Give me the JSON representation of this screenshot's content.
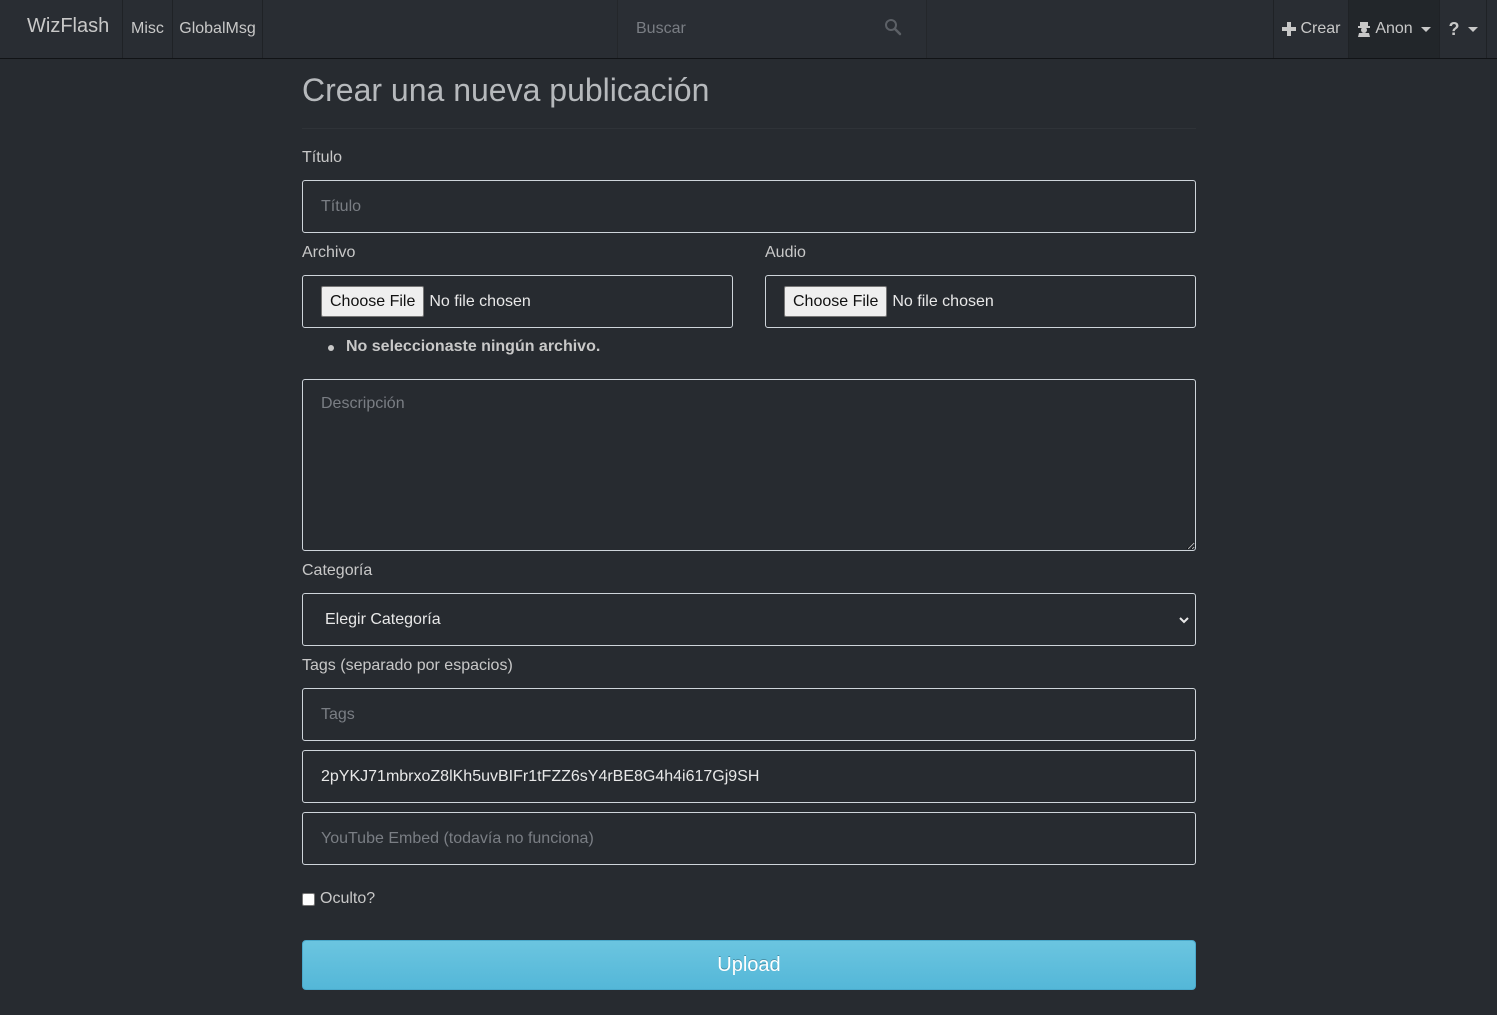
{
  "navbar": {
    "brand": "WizFlash",
    "links": [
      {
        "label": "Misc"
      },
      {
        "label": "GlobalMsg"
      }
    ],
    "search_placeholder": "Buscar",
    "create_label": "Crear",
    "user_label": "Anon",
    "help_label": "?"
  },
  "form": {
    "heading": "Crear una nueva publicación",
    "title_label": "Título",
    "title_placeholder": "Título",
    "file_label": "Archivo",
    "audio_label": "Audio",
    "choose_file_button": "Choose File",
    "no_file_text": "No file chosen",
    "file_error": "No seleccionaste ningún archivo.",
    "description_placeholder": "Descripción",
    "category_label": "Categoría",
    "category_selected": "Elegir Categoría",
    "tags_label": "Tags (separado por espacios)",
    "tags_placeholder": "Tags",
    "token_value": "2pYKJ71mbrxoZ8lKh5uvBIFr1tFZZ6sY4rBE8G4h4i617Gj9SH",
    "youtube_placeholder": "YouTube Embed (todavía no funciona)",
    "hidden_label": "Oculto?",
    "upload_button": "Upload"
  },
  "colors": {
    "background": "#272b30",
    "navbar": "#292d33",
    "accent": "#5bc0de"
  }
}
